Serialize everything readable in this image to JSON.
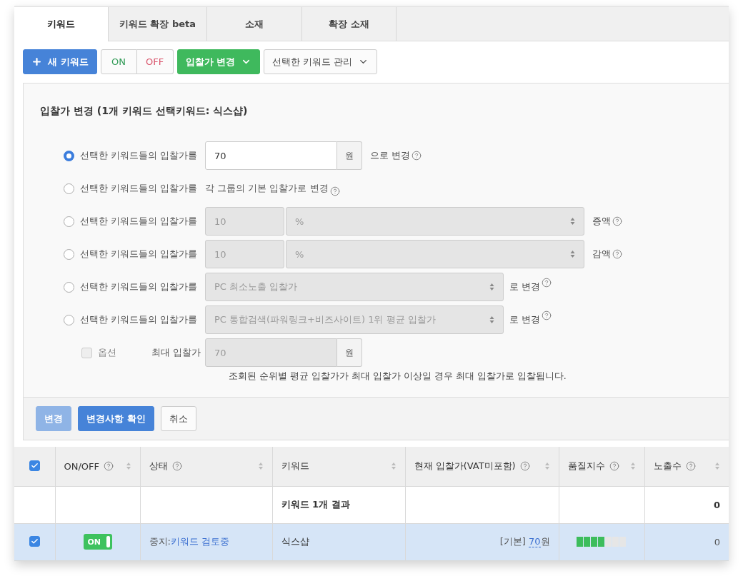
{
  "tabs": [
    {
      "label": "키워드",
      "selected": true
    },
    {
      "label": "키워드 확장 beta",
      "selected": false
    },
    {
      "label": "소재",
      "selected": false
    },
    {
      "label": "확장 소재",
      "selected": false
    }
  ],
  "toolbar": {
    "new_button": "새 키워드",
    "on_button": "ON",
    "off_button": "OFF",
    "bid_button": "입찰가 변경",
    "manage_dropdown": "선택한 키워드 관리"
  },
  "bid_panel": {
    "title": "입찰가 변경 (1개 키워드 선택키워드: 식스샵)",
    "options": [
      {
        "kind": "amount",
        "selected": true,
        "label": "선택한 키워드들의 입찰가를",
        "value": "70",
        "unit": "원",
        "suffix": "으로 변경",
        "disabled": false
      },
      {
        "kind": "default",
        "selected": false,
        "label": "선택한 키워드들의 입찰가를",
        "text": "각 그룹의 기본 입찰가로 변경"
      },
      {
        "kind": "percent",
        "selected": false,
        "label": "선택한 키워드들의 입찰가를",
        "value": "10",
        "select": "%",
        "suffix": "증액",
        "disabled": true
      },
      {
        "kind": "percent",
        "selected": false,
        "label": "선택한 키워드들의 입찰가를",
        "value": "10",
        "select": "%",
        "suffix": "감액",
        "disabled": true
      },
      {
        "kind": "select",
        "selected": false,
        "label": "선택한 키워드들의 입찰가를",
        "select": "PC 최소노출 입찰가",
        "suffix": "로 변경",
        "disabled": true
      },
      {
        "kind": "select",
        "selected": false,
        "label": "선택한 키워드들의 입찰가를",
        "select": "PC 통합검색(파워링크+비즈사이트) 1위 평균 입찰가",
        "suffix": "로 변경",
        "disabled": true
      }
    ],
    "max_bid": {
      "option_label": "옵션",
      "checked": false,
      "disabled": true,
      "label": "최대 입찰가",
      "value": "70",
      "unit": "원",
      "note": "조회된 순위별 평균 입찰가가 최대 입찰가 이상일 경우 최대 입찰가로 입찰됩니다."
    },
    "buttons": [
      {
        "label": "변경",
        "kind": "primary",
        "disabled": true
      },
      {
        "label": "변경사항 확인",
        "kind": "primary",
        "disabled": false
      },
      {
        "label": "취소",
        "kind": "default",
        "disabled": false
      }
    ]
  },
  "table": {
    "select_all": true,
    "columns": [
      {
        "label": "ON/OFF",
        "help": true
      },
      {
        "label": "상태",
        "help": true
      },
      {
        "label": "키워드",
        "help": false
      },
      {
        "label": "현재 입찰가(VAT미포함)",
        "help": true
      },
      {
        "label": "품질지수",
        "help": true
      },
      {
        "label": "노출수",
        "help": true
      }
    ],
    "summary": {
      "keyword": "키워드 1개 결과",
      "impressions": "0"
    },
    "rows": [
      {
        "selected": true,
        "switch": {
          "on": true,
          "label": "ON"
        },
        "status": "중지:",
        "status_link": "키워드 검토중",
        "keyword": "식스샵",
        "bid_tag": "[기본]",
        "bid": "70",
        "bid_unit": "원",
        "quality": {
          "level": 0.5714
        },
        "impressions": "0"
      }
    ]
  }
}
